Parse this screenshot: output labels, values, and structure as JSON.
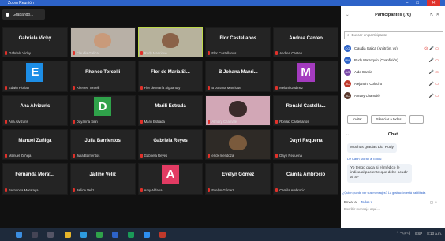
{
  "window": {
    "title": "Zoom Reunión",
    "controls": [
      "–",
      "□",
      "✕"
    ]
  },
  "recording": {
    "label": "Grabando..."
  },
  "tiles": [
    {
      "center": "Gabriela Vichy",
      "footer": "Gabriela Vichy",
      "kind": "name"
    },
    {
      "center": "",
      "footer": "Claudia Galica",
      "kind": "photo",
      "bg": "#b8b0a6",
      "face": "#c99a7a"
    },
    {
      "center": "",
      "footer": "Rudy Manrique",
      "kind": "photo",
      "bg": "#b7b29c",
      "face": "#8a6248",
      "active": true
    },
    {
      "center": "Flor Castellanos",
      "footer": "Flor Castellanos",
      "kind": "name"
    },
    {
      "center": "Andrea Canteo",
      "footer": "Andrea Canteo",
      "kind": "name"
    },
    {
      "center": "E",
      "footer": "Edwin Florian",
      "kind": "avatar",
      "color": "#1d8ee6"
    },
    {
      "center": "Rhenee Torcelli",
      "footer": "Rhenee Torcelli",
      "kind": "name"
    },
    {
      "center": "Flor de María Si...",
      "footer": "Flor de María Siguantay",
      "kind": "name"
    },
    {
      "center": "B Johana Manri...",
      "footer": "B Johana Manrique",
      "kind": "name"
    },
    {
      "center": "M",
      "footer": "Melani Godinez",
      "kind": "avatar",
      "color": "#a43bbf"
    },
    {
      "center": "Ana Alvizuris",
      "footer": "Ana Alvizuris",
      "kind": "name"
    },
    {
      "center": "D",
      "footer": "Dayanna Sirin",
      "kind": "avatar",
      "color": "#2fa24a"
    },
    {
      "center": "Marili Estrada",
      "footer": "Marili Estrada",
      "kind": "name"
    },
    {
      "center": "",
      "footer": "Almary Chamalé",
      "kind": "photo",
      "bg": "#d2a7b6",
      "face": "#3a2a2a"
    },
    {
      "center": "Ronald Castella...",
      "footer": "Ronald Castellanos",
      "kind": "name"
    },
    {
      "center": "Manuel Zuñiga",
      "footer": "Manuel Zuñiga",
      "kind": "name"
    },
    {
      "center": "Julia Barrientos",
      "footer": "Julia Barrientos",
      "kind": "name"
    },
    {
      "center": "Gabriela Reyes",
      "footer": "Gabriela Reyes",
      "kind": "name"
    },
    {
      "center": "",
      "footer": "erick mendoza",
      "kind": "photo",
      "bg": "#2e2a26",
      "face": "#7a5a3c"
    },
    {
      "center": "Dayri Requena",
      "footer": "Dayri Requena",
      "kind": "name"
    },
    {
      "center": "Fernanda Morat...",
      "footer": "Fernanda Morataya",
      "kind": "name"
    },
    {
      "center": "Jailine Veliz",
      "footer": "Jailine Veliz",
      "kind": "name"
    },
    {
      "center": "A",
      "footer": "Amy Aldana",
      "kind": "avatar",
      "color": "#e23b63"
    },
    {
      "center": "Evelyn Gómez",
      "footer": "Evelyn Gómez",
      "kind": "name"
    },
    {
      "center": "Camila Ambrocio",
      "footer": "Camila Ambrocio",
      "kind": "name"
    }
  ],
  "participants": {
    "title": "Participantes (76)",
    "search_placeholder": "Buscar un participante",
    "items": [
      {
        "initials": "CG",
        "name": "Claudia Galica (Anfitrión, yo)",
        "color": "#2d63c8",
        "icons": "⊙ 🎤 ▭"
      },
      {
        "initials": "RM",
        "name": "Rudy Marroquín (Coanfitrión)",
        "color": "#2d63c8",
        "icons": "🎤 ▭"
      },
      {
        "initials": "AG",
        "name": "Aldo García",
        "color": "#7a4aa8",
        "icons": "🎤 ▭"
      },
      {
        "initials": "AC",
        "name": "Alejandro Colocho",
        "color": "#c0392b",
        "icons": "🎤 ▭"
      },
      {
        "initials": "AC",
        "name": "Almary Chamalé",
        "color": "#5b3a2e",
        "icons": "🎤 ▭"
      }
    ],
    "buttons": [
      "Invitar",
      "Silenciar a todos",
      "..."
    ]
  },
  "chat": {
    "title": "Chat",
    "message1": "Muchas gracias Lic. Rudy",
    "from_line": "De Karin Morán a Todos:",
    "message2": "Yo tengo duda si el médico le indica al paciente que debe acudir al SF",
    "notice": "¿Quién puede ver sus mensajes? La grabación está habilitada",
    "send_to_label": "Enviar a:",
    "send_to_value": "Todos ▾",
    "message_placeholder": "Escribir mensaje aquí..."
  },
  "taskbar": {
    "time": "8:13 a.m.",
    "lang": "ESP"
  },
  "colors": {
    "accent": "#2d63c8",
    "active_border": "#bcd84a",
    "muted_mic": "#e0312a"
  }
}
